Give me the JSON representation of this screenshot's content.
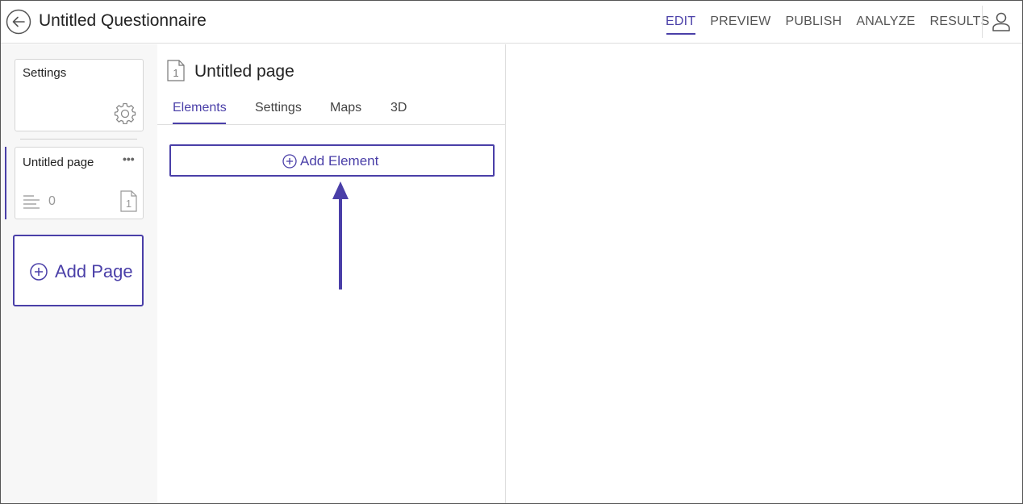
{
  "header": {
    "title": "Untitled Questionnaire",
    "nav": [
      {
        "label": "EDIT",
        "active": true
      },
      {
        "label": "PREVIEW",
        "active": false
      },
      {
        "label": "PUBLISH",
        "active": false
      },
      {
        "label": "ANALYZE",
        "active": false
      },
      {
        "label": "RESULTS",
        "active": false
      }
    ],
    "icons": {
      "back": "arrow-left-circle-icon",
      "user": "user-icon"
    }
  },
  "sidebar": {
    "settings_card": {
      "label": "Settings",
      "icon": "gear-icon"
    },
    "page_card": {
      "label": "Untitled page",
      "more": "•••",
      "element_count": "0",
      "page_number": "1"
    },
    "add_page": {
      "label": "Add Page"
    }
  },
  "editor": {
    "page_title": "Untitled page",
    "page_number": "1",
    "tabs": [
      {
        "label": "Elements",
        "active": true
      },
      {
        "label": "Settings",
        "active": false
      },
      {
        "label": "Maps",
        "active": false
      },
      {
        "label": "3D",
        "active": false
      }
    ],
    "add_element": {
      "label": "Add Element"
    }
  },
  "colors": {
    "accent": "#4a3fa8",
    "border": "#dedede",
    "sidebar_bg": "#f7f7f7"
  }
}
